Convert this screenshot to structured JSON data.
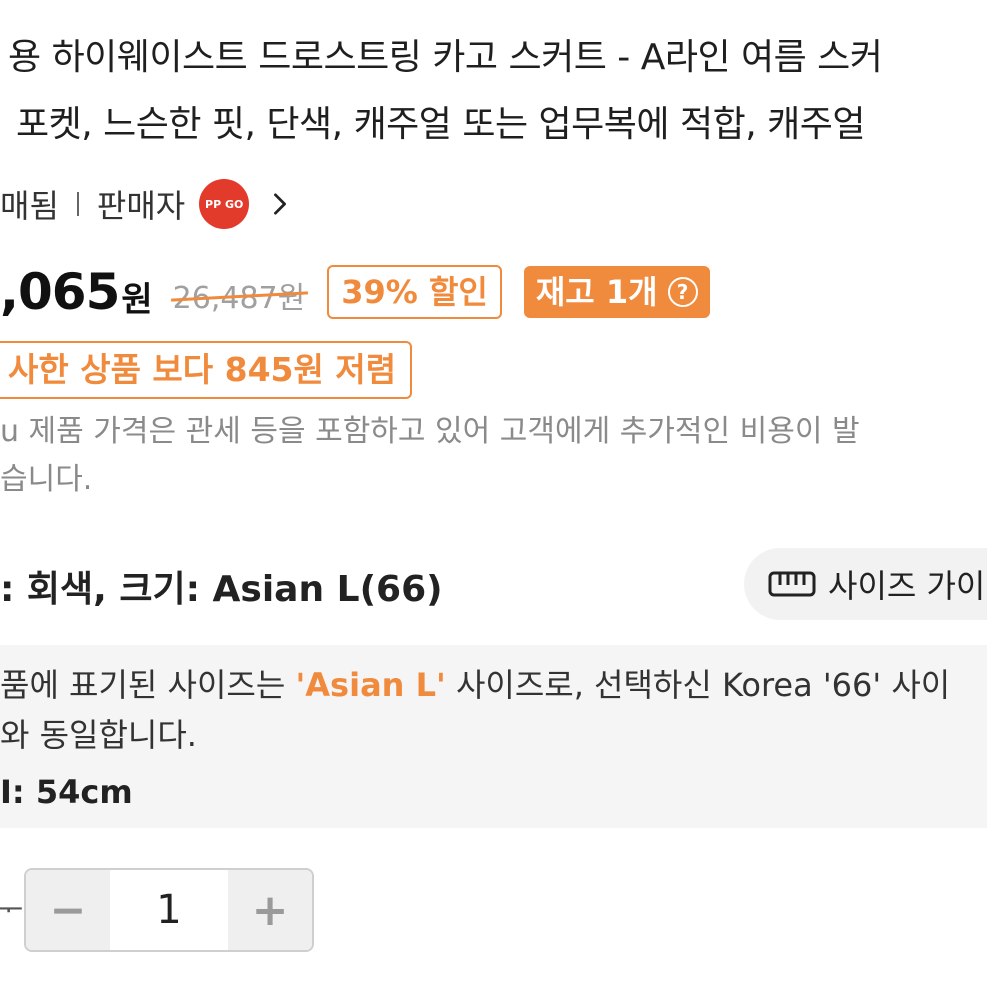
{
  "product": {
    "title_line1": "용 하이웨이스트 드로스트링 카고 스커트 - A라인 여름 스커",
    "title_line2": "포켓, 느슨한 핏, 단색, 캐주얼 또는 업무복에 적합, 캐주얼"
  },
  "seller": {
    "sold_text": "매됨",
    "label": "판매자",
    "logo_text": "PP GO",
    "arrow_icon": "chevron-right-icon"
  },
  "price": {
    "current": ",065",
    "unit": "원",
    "original": "26,487원",
    "discount_label": "39% 할인",
    "stock_label": "재고 1개",
    "stock_help_icon": "question-circle-icon",
    "help_glyph": "?",
    "accent_color": "#f08a3c"
  },
  "comparison": {
    "text": "사한 상품 보다 845원 저렴"
  },
  "notice": {
    "line1": "u 제품 가격은 관세 등을 포함하고 있어 고객에게 추가적인 비용이 발",
    "line2": "습니다."
  },
  "option": {
    "selected_text": ": 회색, 크기: Asian L(66)",
    "size_guide_label": "사이즈 가이",
    "size_guide_icon": "ruler-icon"
  },
  "size_info": {
    "line1_pre": "품에 표기된 사이즈는 ",
    "line1_accent": "'Asian L'",
    "line1_post": " 사이즈로, 선택하신 Korea '66' 사이",
    "line2": "와 동일합니다.",
    "line3": "I: 54cm"
  },
  "quantity": {
    "label": "ᅮ",
    "value": "1",
    "minus_glyph": "−",
    "plus_glyph": "+"
  }
}
